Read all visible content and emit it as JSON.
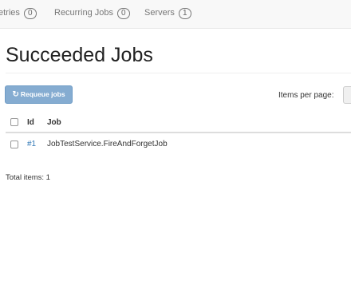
{
  "nav": {
    "items": [
      {
        "label": "etries",
        "count": "0"
      },
      {
        "label": "Recurring Jobs",
        "count": "0"
      },
      {
        "label": "Servers",
        "count": "1"
      }
    ]
  },
  "page": {
    "title": "Succeeded Jobs"
  },
  "toolbar": {
    "requeue_label": "Requeue jobs",
    "requeue_icon": "refresh-icon",
    "items_per_page_label": "Items per page:"
  },
  "table": {
    "headers": {
      "id": "Id",
      "job": "Job"
    },
    "rows": [
      {
        "id": "#1",
        "job": "JobTestService.FireAndForgetJob"
      }
    ]
  },
  "footer": {
    "total_items": "Total items: 1"
  },
  "colors": {
    "primary_button": "#85acd1",
    "link": "#337ab7",
    "navbar": "#f8f8f8"
  }
}
